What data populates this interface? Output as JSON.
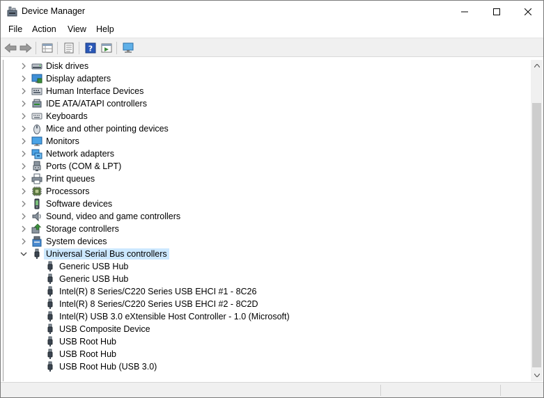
{
  "window": {
    "title": "Device Manager",
    "icon": "device-manager-icon"
  },
  "menu": [
    "File",
    "Action",
    "View",
    "Help"
  ],
  "toolbar": {
    "buttons": [
      "back-arrow-icon",
      "forward-arrow-icon",
      "properties-grid-icon",
      "device-list-icon",
      "help-icon",
      "run-icon",
      "computer-monitor-icon"
    ]
  },
  "tree": {
    "categories": [
      {
        "label": "Disk drives",
        "icon": "disk-drive-icon",
        "expanded": false
      },
      {
        "label": "Display adapters",
        "icon": "display-adapter-icon",
        "expanded": false
      },
      {
        "label": "Human Interface Devices",
        "icon": "hid-icon",
        "expanded": false
      },
      {
        "label": "IDE ATA/ATAPI controllers",
        "icon": "ide-controller-icon",
        "expanded": false
      },
      {
        "label": "Keyboards",
        "icon": "keyboard-icon",
        "expanded": false
      },
      {
        "label": "Mice and other pointing devices",
        "icon": "mouse-icon",
        "expanded": false
      },
      {
        "label": "Monitors",
        "icon": "monitor-icon",
        "expanded": false
      },
      {
        "label": "Network adapters",
        "icon": "network-adapter-icon",
        "expanded": false
      },
      {
        "label": "Ports (COM & LPT)",
        "icon": "port-icon",
        "expanded": false
      },
      {
        "label": "Print queues",
        "icon": "printer-icon",
        "expanded": false
      },
      {
        "label": "Processors",
        "icon": "processor-icon",
        "expanded": false
      },
      {
        "label": "Software devices",
        "icon": "software-device-icon",
        "expanded": false
      },
      {
        "label": "Sound, video and game controllers",
        "icon": "speaker-icon",
        "expanded": false
      },
      {
        "label": "Storage controllers",
        "icon": "storage-controller-icon",
        "expanded": false
      },
      {
        "label": "System devices",
        "icon": "system-device-icon",
        "expanded": false
      },
      {
        "label": "Universal Serial Bus controllers",
        "icon": "usb-icon",
        "expanded": true,
        "selected": true
      }
    ],
    "usb_children": [
      "Generic USB Hub",
      "Generic USB Hub",
      "Intel(R) 8 Series/C220 Series USB EHCI #1 - 8C26",
      "Intel(R) 8 Series/C220 Series USB EHCI #2 - 8C2D",
      "Intel(R) USB 3.0 eXtensible Host Controller - 1.0 (Microsoft)",
      "USB Composite Device",
      "USB Root Hub",
      "USB Root Hub",
      "USB Root Hub (USB 3.0)"
    ]
  },
  "colors": {
    "selection": "#cce8ff",
    "toolbar_bg": "#f0f0f0",
    "scroll_thumb": "#cdcdcd"
  }
}
